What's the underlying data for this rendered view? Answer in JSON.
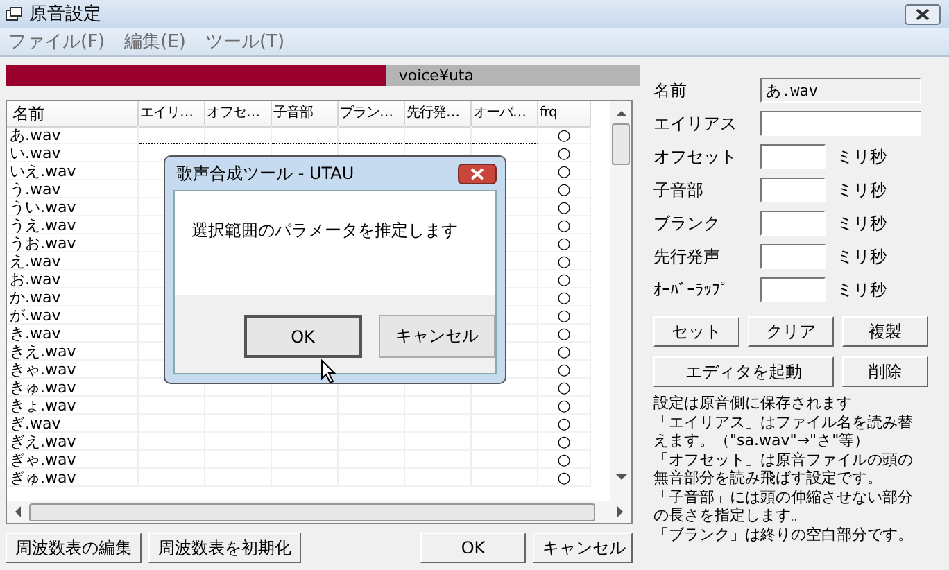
{
  "window": {
    "title": "原音設定"
  },
  "menu": [
    "ファイル(F)",
    "編集(E)",
    "ツール(T)"
  ],
  "path_bar": {
    "text": "voice¥uta",
    "level": 0.6
  },
  "table": {
    "columns": [
      "名前",
      "エイリ…",
      "オフセ…",
      "子音部",
      "ブラン…",
      "先行発…",
      "オーバ…",
      "frq"
    ],
    "rows": [
      {
        "name": "あ.wav",
        "frq": "○",
        "selected": true
      },
      {
        "name": "い.wav",
        "frq": "○",
        "selected": false
      },
      {
        "name": "いえ.wav",
        "frq": "○",
        "selected": false
      },
      {
        "name": "う.wav",
        "frq": "○",
        "selected": false
      },
      {
        "name": "うい.wav",
        "frq": "○",
        "selected": false
      },
      {
        "name": "うえ.wav",
        "frq": "○",
        "selected": false
      },
      {
        "name": "うお.wav",
        "frq": "○",
        "selected": false
      },
      {
        "name": "え.wav",
        "frq": "○",
        "selected": false
      },
      {
        "name": "お.wav",
        "frq": "○",
        "selected": false
      },
      {
        "name": "か.wav",
        "frq": "○",
        "selected": false
      },
      {
        "name": "が.wav",
        "frq": "○",
        "selected": false
      },
      {
        "name": "き.wav",
        "frq": "○",
        "selected": false
      },
      {
        "name": "きえ.wav",
        "frq": "○",
        "selected": false
      },
      {
        "name": "きゃ.wav",
        "frq": "○",
        "selected": false
      },
      {
        "name": "きゅ.wav",
        "frq": "○",
        "selected": false
      },
      {
        "name": "きょ.wav",
        "frq": "○",
        "selected": false
      },
      {
        "name": "ぎ.wav",
        "frq": "○",
        "selected": false
      },
      {
        "name": "ぎえ.wav",
        "frq": "○",
        "selected": false
      },
      {
        "name": "ぎゃ.wav",
        "frq": "○",
        "selected": false
      },
      {
        "name": "ぎゅ.wav",
        "frq": "○",
        "selected": false
      }
    ]
  },
  "bottom_buttons": [
    "周波数表の編集",
    "周波数表を初期化",
    "OK",
    "キャンセル"
  ],
  "fields": [
    {
      "label": "名前",
      "value": "あ.wav",
      "kind": "wide",
      "readonly": true
    },
    {
      "label": "エイリアス",
      "kind": "wide",
      "readonly": false
    },
    {
      "label": "オフセット",
      "unit": "ミリ秒",
      "kind": "short"
    },
    {
      "label": "子音部",
      "unit": "ミリ秒",
      "kind": "short"
    },
    {
      "label": "ブランク",
      "unit": "ミリ秒",
      "kind": "short"
    },
    {
      "label": "先行発声",
      "unit": "ミリ秒",
      "kind": "short"
    },
    {
      "label": "ｵｰﾊﾞｰﾗｯﾌﾟ",
      "unit": "ミリ秒",
      "kind": "short"
    }
  ],
  "action_buttons": [
    [
      "セット",
      "クリア",
      "複製"
    ],
    [
      "エディタを起動",
      "削除"
    ]
  ],
  "help": [
    "設定は原音側に保存されます",
    "「エイリアス」はファイル名を読み替えます。（\"sa.wav\"→\"さ\"等）",
    "「オフセット」は原音ファイルの頭の無音部分を読み飛ばす設定です。",
    "「子音部」には頭の伸縮させない部分の長さを指定します。",
    "「ブランク」は終りの空白部分です。"
  ],
  "dialog": {
    "title": "歌声合成ツール - UTAU",
    "message": "選択範囲のパラメータを推定します",
    "buttons": [
      {
        "label": "OK",
        "selected": true
      },
      {
        "label": "キャンセル",
        "selected": false
      }
    ]
  }
}
